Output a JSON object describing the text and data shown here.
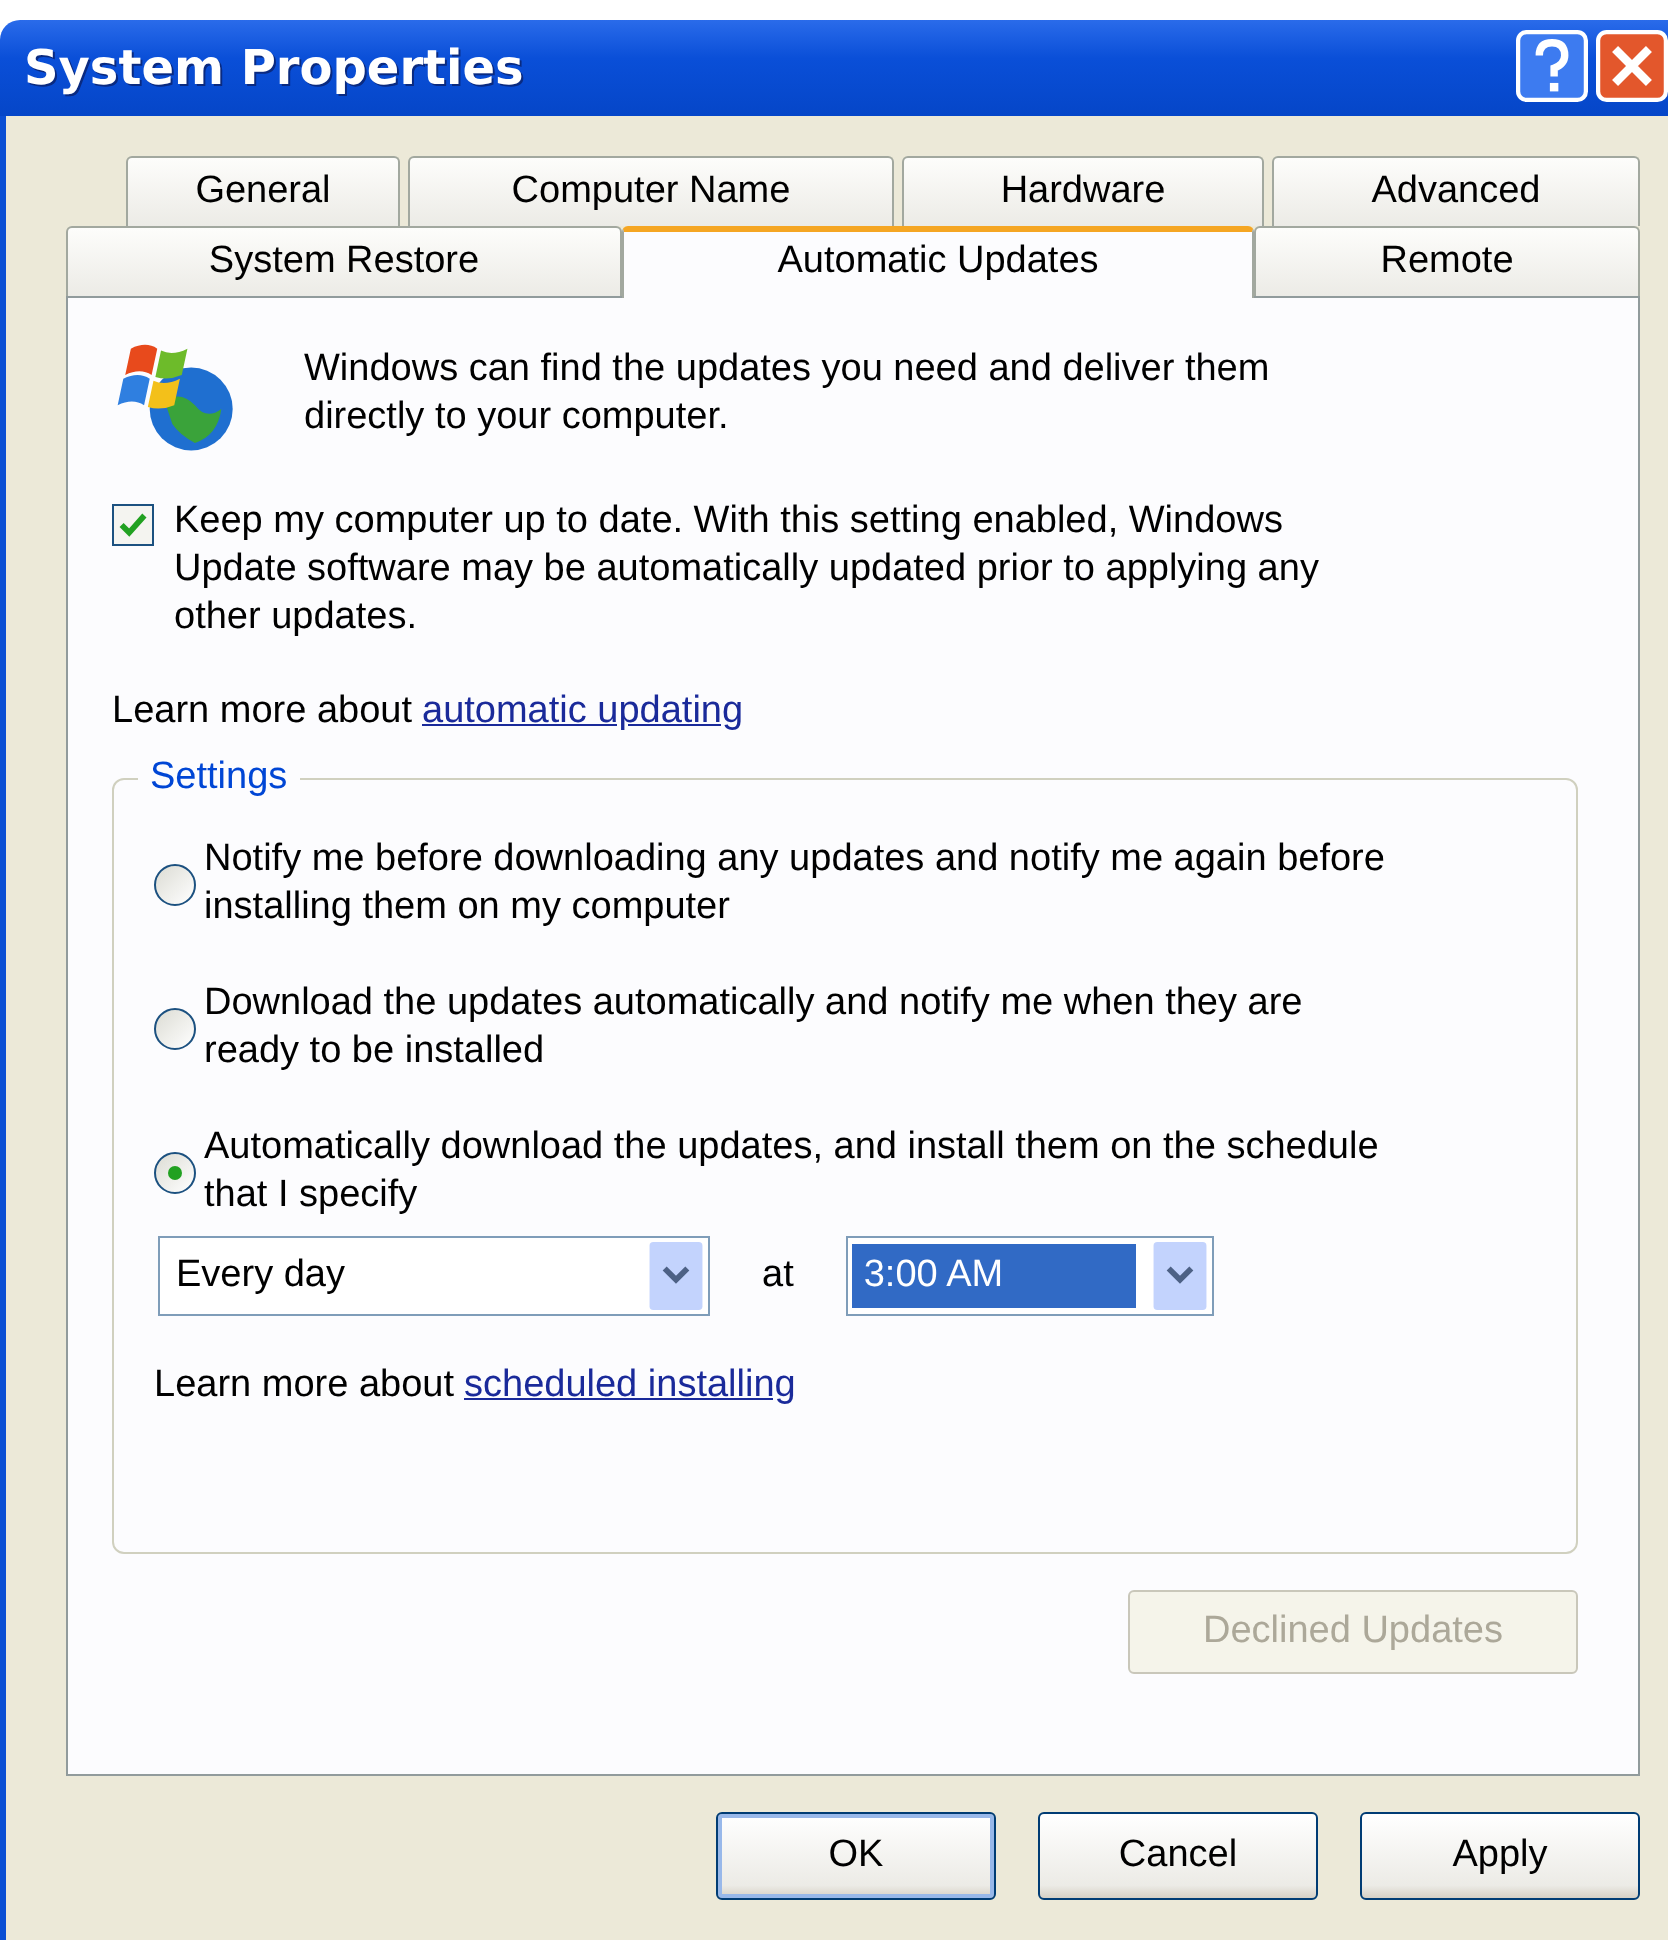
{
  "window": {
    "title": "System Properties"
  },
  "tab_rows": [
    [
      {
        "label": "General",
        "selected": false
      },
      {
        "label": "Computer Name",
        "selected": false
      },
      {
        "label": "Hardware",
        "selected": false
      },
      {
        "label": "Advanced",
        "selected": false
      }
    ],
    [
      {
        "label": "System Restore",
        "selected": false
      },
      {
        "label": "Automatic Updates",
        "selected": true
      },
      {
        "label": "Remote",
        "selected": false
      }
    ]
  ],
  "intro": "Windows can find the updates you need and deliver them directly to your computer.",
  "keep_up_to_date": {
    "label": "Keep my computer up to date. With this setting enabled, Windows Update software may be automatically updated prior to applying any other updates.",
    "checked": true
  },
  "learn_more": {
    "text": "Learn more about",
    "link": "automatic updating"
  },
  "settings": {
    "legend": "Settings",
    "options": [
      {
        "label": "Notify me before downloading any updates and notify me again before installing them on my computer",
        "selected": false
      },
      {
        "label": "Download the updates automatically and notify me when they are ready to be installed",
        "selected": false
      },
      {
        "label": "Automatically download the updates, and install them on the schedule that I specify",
        "selected": true
      }
    ],
    "schedule": {
      "day": "Every day",
      "at_label": "at",
      "time": "3:00 AM",
      "time_highlighted": true
    },
    "learn_more": {
      "text": "Learn more about",
      "link": "scheduled installing"
    }
  },
  "declined_updates": {
    "label": "Declined Updates",
    "disabled": true
  },
  "buttons": [
    {
      "label": "OK",
      "default": true
    },
    {
      "label": "Cancel",
      "default": false
    },
    {
      "label": "Apply",
      "default": false
    }
  ]
}
